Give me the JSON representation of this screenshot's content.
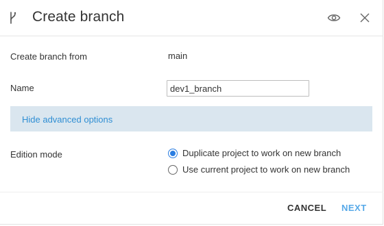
{
  "dialog": {
    "title": "Create branch",
    "icons": {
      "branch": "git-branch-icon",
      "preview": "eye-icon",
      "close": "close-icon"
    }
  },
  "form": {
    "from": {
      "label": "Create branch from",
      "value": "main"
    },
    "name": {
      "label": "Name",
      "value": "dev1_branch"
    },
    "advanced_toggle": "Hide advanced options",
    "edition_mode": {
      "label": "Edition mode",
      "options": [
        {
          "label": "Duplicate project to work on new branch",
          "selected": true
        },
        {
          "label": "Use current project to work on new branch",
          "selected": false
        }
      ]
    }
  },
  "footer": {
    "cancel_label": "CANCEL",
    "next_label": "NEXT"
  },
  "colors": {
    "accent": "#2a7de1",
    "link": "#2f8ed3",
    "next_button": "#57a9e8",
    "advanced_bg": "#dae6ef"
  }
}
